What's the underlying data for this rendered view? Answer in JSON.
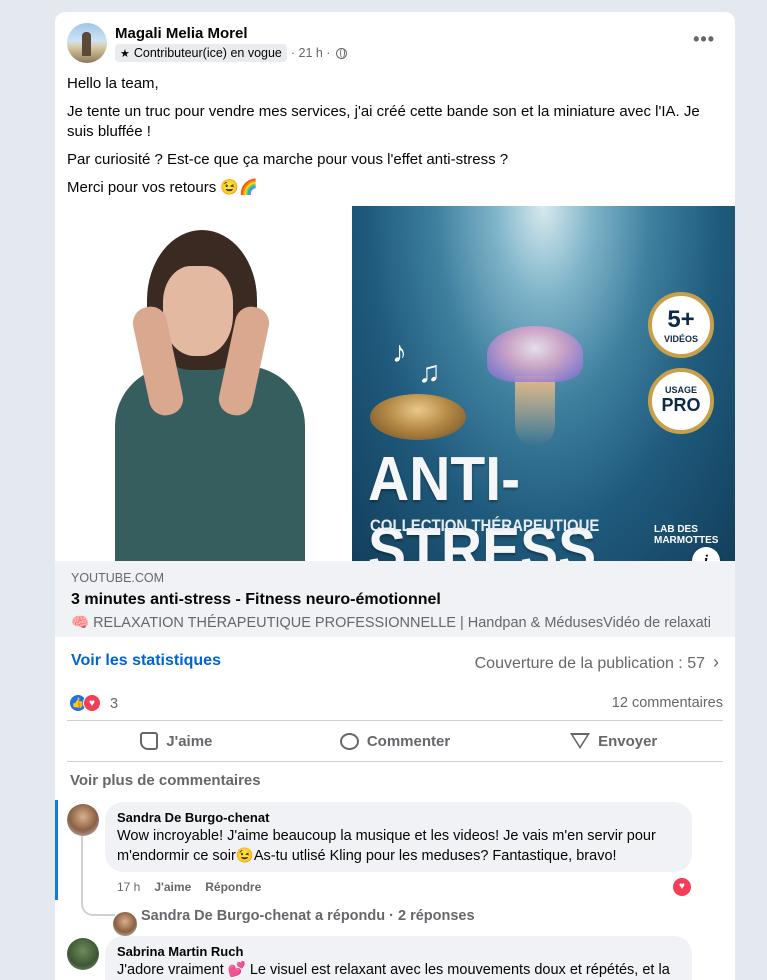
{
  "post": {
    "author": "Magali Melia Morel",
    "badge": "Contributeur(ice) en vogue",
    "time": "· 21 h ·",
    "more_label": "•••",
    "paragraphs": [
      "Hello la team,",
      "Je tente un truc pour vendre mes services, j'ai créé cette bande son et la miniature avec l'IA. Je suis bluffée !",
      "Par curiosité ? Est-ce que ça marche pour vous l'effet anti-stress ?",
      "Merci pour vos retours 😉🌈"
    ]
  },
  "thumbnail": {
    "title": "ANTI-STRESS",
    "subtitle": "COLLECTION THÉRAPEUTIQUE",
    "badge_top_big": "5+",
    "badge_top_small": "VIDÉOS",
    "badge_bottom_small": "USAGE",
    "badge_bottom_big": "PRO",
    "lab": "LAB DES\nMARMOTTES",
    "info_label": "i"
  },
  "link": {
    "domain": "YOUTUBE.COM",
    "title": "3 minutes anti-stress - Fitness neuro-émotionnel",
    "description": "🧠 RELAXATION THÉRAPEUTIQUE PROFESSIONNELLE | Handpan & MédusesVidéo de relaxati..."
  },
  "stats": {
    "see_stats": "Voir les statistiques",
    "coverage": "Couverture de la publication : 57"
  },
  "reactions": {
    "count": "3",
    "comments": "12 commentaires"
  },
  "actions": {
    "like": "J'aime",
    "comment": "Commenter",
    "send": "Envoyer"
  },
  "comments": {
    "see_more": "Voir plus de commentaires",
    "items": [
      {
        "name": "Sandra De Burgo-chenat",
        "text": "Wow incroyable! J'aime beaucoup la musique et les videos! Je vais m'en servir pour m'endormir ce soir😉As-tu utlisé Kling pour les meduses? Fantastique, bravo!",
        "time": "17 h",
        "like": "J'aime",
        "reply": "Répondre"
      },
      {
        "name": "Sabrina Martin Ruch",
        "text": "J'adore vraiment 💕 Le visuel est relaxant avec les mouvements doux et répétés, et la"
      }
    ],
    "reply_summary": "Sandra De Burgo-chenat a répondu · 2 réponses"
  },
  "colors": {
    "accent": "#0064d1",
    "like_blue": "#1b74e4",
    "love_red": "#f33e58",
    "background": "#e4e8ef"
  }
}
